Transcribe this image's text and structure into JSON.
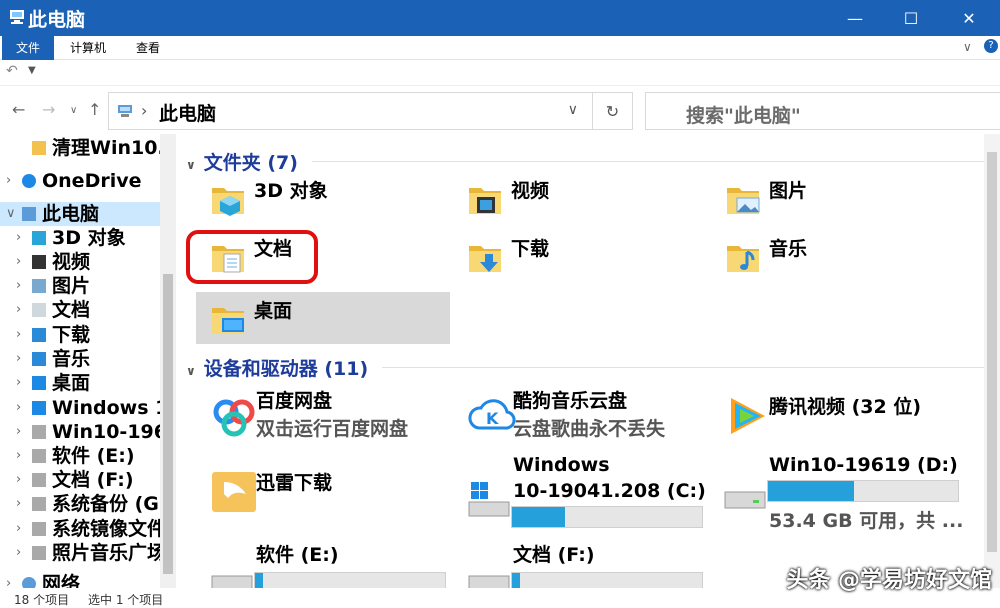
{
  "window": {
    "title": "此电脑"
  },
  "ribbon": {
    "tabs": [
      "文件",
      "计算机",
      "查看"
    ]
  },
  "address": {
    "path": "此电脑"
  },
  "search": {
    "placeholder": "搜索\"此电脑\""
  },
  "sidebar": {
    "items": [
      {
        "label": "清理Win10.",
        "icon": "folder-icon"
      },
      {
        "label": "OneDrive",
        "icon": "cloud-icon"
      },
      {
        "label": "此电脑",
        "icon": "computer-icon"
      },
      {
        "label": "3D 对象",
        "icon": "cube-icon"
      },
      {
        "label": "视频",
        "icon": "video-icon"
      },
      {
        "label": "图片",
        "icon": "picture-icon"
      },
      {
        "label": "文档",
        "icon": "document-icon"
      },
      {
        "label": "下载",
        "icon": "download-icon"
      },
      {
        "label": "音乐",
        "icon": "music-icon"
      },
      {
        "label": "桌面",
        "icon": "desktop-icon"
      },
      {
        "label": "Windows 1",
        "icon": "windows-drive-icon"
      },
      {
        "label": "Win10-196",
        "icon": "drive-icon"
      },
      {
        "label": "软件 (E:)",
        "icon": "drive-icon"
      },
      {
        "label": "文档 (F:)",
        "icon": "drive-icon"
      },
      {
        "label": "系统备份 (G",
        "icon": "drive-icon"
      },
      {
        "label": "系统镜像文件",
        "icon": "drive-icon"
      },
      {
        "label": "照片音乐广场",
        "icon": "drive-icon"
      },
      {
        "label": "网络",
        "icon": "network-icon"
      }
    ]
  },
  "folders": {
    "header": "文件夹 (7)",
    "items": [
      {
        "name": "3D 对象"
      },
      {
        "name": "视频"
      },
      {
        "name": "图片"
      },
      {
        "name": "文档"
      },
      {
        "name": "下载"
      },
      {
        "name": "音乐"
      },
      {
        "name": "桌面"
      }
    ]
  },
  "devices": {
    "header": "设备和驱动器 (11)",
    "items": [
      {
        "name": "百度网盘",
        "sub": "双击运行百度网盘"
      },
      {
        "name": "酷狗音乐云盘",
        "sub": "云盘歌曲永不丢失"
      },
      {
        "name": "腾讯视频 (32 位)"
      },
      {
        "name": "迅雷下载"
      },
      {
        "name": "Windows 10-19041.208 (C:)",
        "line1": "Windows",
        "line2": "10-19041.208 (C:)",
        "usage": 0.28
      },
      {
        "name": "Win10-19619 (D:)",
        "sub": "53.4 GB 可用，共 ...",
        "usage": 0.45
      },
      {
        "name": "软件 (E:)",
        "usage": 0.04
      },
      {
        "name": "文档 (F:)",
        "usage": 0.04
      }
    ]
  },
  "status": {
    "count": "18 个项目",
    "selected": "选中 1 个项目"
  },
  "watermark": "头条 @学易坊好文馆",
  "colors": {
    "accent": "#1b61b6",
    "selection": "#cce8ff",
    "usage_bar": "#26a0da",
    "highlight_ring": "#e01010"
  }
}
